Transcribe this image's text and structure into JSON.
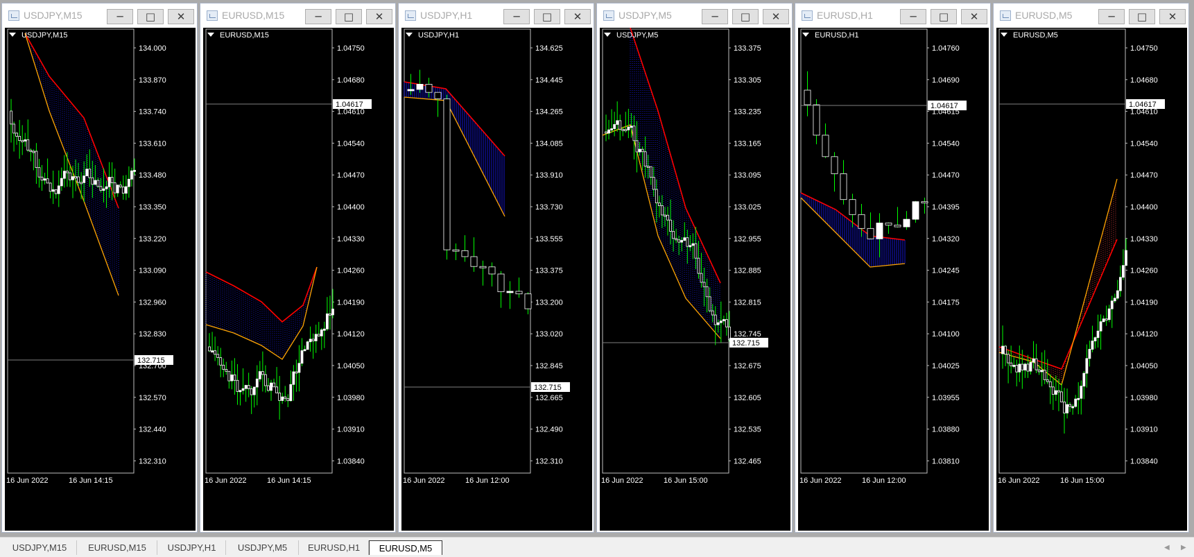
{
  "ui": {
    "workspace_bg": "#ababab",
    "chart_bg": "#000000",
    "bull_candle": "#ffffff",
    "wick_color": "#00ff00",
    "slow_ma_color": "#ff0000",
    "fast_ma_color": "#ffa500",
    "cloud_color": "#1a1aff",
    "bid_line_color": "#808080",
    "window_icon": "chart-window-icon",
    "button_icons": [
      "minimize-icon",
      "maximize-icon",
      "close-icon"
    ],
    "dropdown_icon": "triangle-down-icon"
  },
  "windows": [
    {
      "title": "USDJPY,M15",
      "symbol_label": "USDJPY,M15",
      "price_axis": [
        "134.000",
        "133.870",
        "133.740",
        "133.610",
        "133.480",
        "133.350",
        "133.220",
        "133.090",
        "132.960",
        "132.830",
        "132.700",
        "132.570",
        "132.440",
        "132.310"
      ],
      "bid_price": "132.715",
      "time_axis": [
        "16 Jun 2022",
        "16 Jun 14:15"
      ]
    },
    {
      "title": "EURUSD,M15",
      "symbol_label": "EURUSD,M15",
      "price_axis": [
        "1.04750",
        "1.04680",
        "1.04610",
        "1.04540",
        "1.04470",
        "1.04400",
        "1.04330",
        "1.04260",
        "1.04190",
        "1.04120",
        "1.04050",
        "1.03980",
        "1.03910",
        "1.03840"
      ],
      "bid_price": "1.04617",
      "time_axis": [
        "16 Jun 2022",
        "16 Jun 14:15"
      ]
    },
    {
      "title": "USDJPY,H1",
      "symbol_label": "USDJPY,H1",
      "price_axis": [
        "134.625",
        "134.445",
        "134.265",
        "134.085",
        "133.910",
        "133.730",
        "133.555",
        "133.375",
        "133.200",
        "133.020",
        "132.845",
        "132.665",
        "132.490",
        "132.310"
      ],
      "bid_price": "132.715",
      "time_axis": [
        "16 Jun 2022",
        "16 Jun 12:00"
      ]
    },
    {
      "title": "USDJPY,M5",
      "symbol_label": "USDJPY,M5",
      "price_axis": [
        "133.375",
        "133.305",
        "133.235",
        "133.165",
        "133.095",
        "133.025",
        "132.955",
        "132.885",
        "132.815",
        "132.745",
        "132.675",
        "132.605",
        "132.535",
        "132.465"
      ],
      "bid_price": "132.715",
      "time_axis": [
        "16 Jun 2022",
        "16 Jun 15:00"
      ]
    },
    {
      "title": "EURUSD,H1",
      "symbol_label": "EURUSD,H1",
      "price_axis": [
        "1.04760",
        "1.04690",
        "1.04615",
        "1.04540",
        "1.04470",
        "1.04395",
        "1.04320",
        "1.04245",
        "1.04175",
        "1.04100",
        "1.04025",
        "1.03955",
        "1.03880",
        "1.03810"
      ],
      "bid_price": "1.04617",
      "time_axis": [
        "16 Jun 2022",
        "16 Jun 12:00"
      ]
    },
    {
      "title": "EURUSD,M5",
      "symbol_label": "EURUSD,M5",
      "price_axis": [
        "1.04750",
        "1.04680",
        "1.04610",
        "1.04540",
        "1.04470",
        "1.04400",
        "1.04330",
        "1.04260",
        "1.04190",
        "1.04120",
        "1.04050",
        "1.03980",
        "1.03910",
        "1.03840"
      ],
      "bid_price": "1.04617",
      "time_axis": [
        "16 Jun 2022",
        "16 Jun 15:00"
      ]
    }
  ],
  "tabs": [
    "USDJPY,M15",
    "EURUSD,M15",
    "USDJPY,H1",
    "USDJPY,M5",
    "EURUSD,H1",
    "EURUSD,M5"
  ],
  "active_tab": "EURUSD,M5"
}
